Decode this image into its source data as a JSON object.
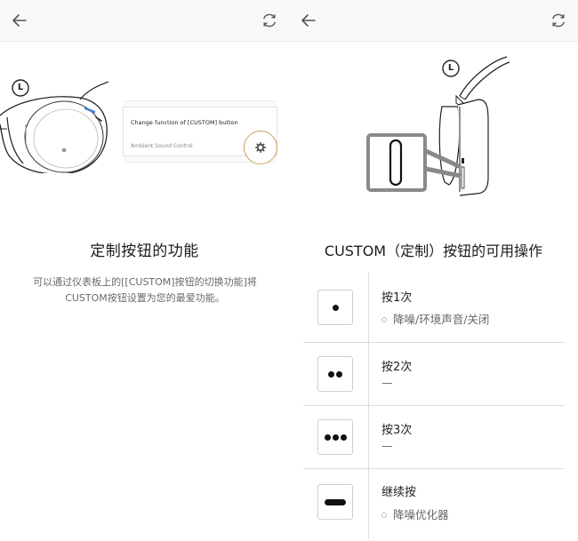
{
  "left": {
    "toolbar": {
      "back_icon": "arrow-left-icon",
      "refresh_icon": "refresh-icon"
    },
    "illustration": {
      "side_badge": "L",
      "dashboard_item_title": "Change function of [CUSTOM] button",
      "dashboard_item_value": "Ambient Sound Control",
      "settings_icon": "gear-icon"
    },
    "title": "定制按钮的功能",
    "description": "可以通过仪表板上的[[CUSTOM]按钮的切换功能]将CUSTOM按钮设置为您的最爱功能。"
  },
  "right": {
    "toolbar": {
      "back_icon": "arrow-left-icon",
      "refresh_icon": "refresh-icon"
    },
    "illustration": {
      "side_badge": "L"
    },
    "title": "CUSTOM（定制）按钮的可用操作",
    "operations": [
      {
        "icon": "single-press-icon",
        "action": "按1次",
        "result": "降噪/环境声音/关闭",
        "has_bullet": true
      },
      {
        "icon": "double-press-icon",
        "action": "按2次",
        "result": "—",
        "has_bullet": false
      },
      {
        "icon": "triple-press-icon",
        "action": "按3次",
        "result": "—",
        "has_bullet": false
      },
      {
        "icon": "press-and-hold-icon",
        "action": "继续按",
        "result": "降噪优化器",
        "has_bullet": true
      }
    ]
  },
  "colors": {
    "toolbar_bg": "#f8f8f8",
    "accent_ring": "#c9a25a",
    "divider": "#dcdcdc"
  }
}
